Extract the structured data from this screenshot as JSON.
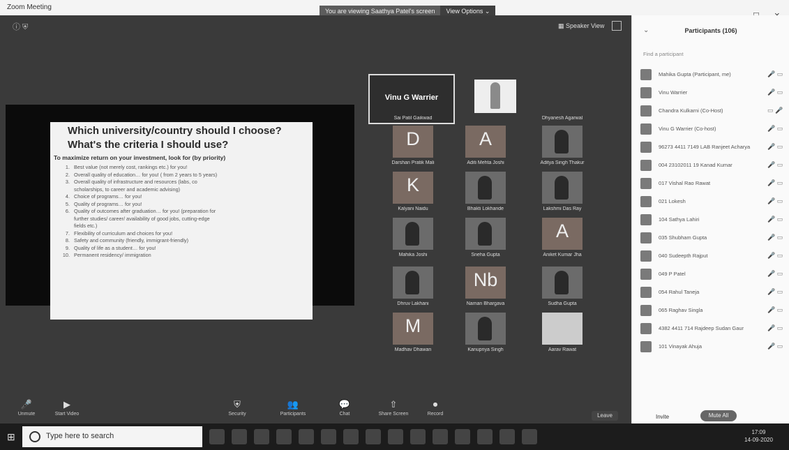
{
  "window": {
    "title": "Zoom Meeting",
    "minimize": "–",
    "maximize": "□",
    "close": "×"
  },
  "view_bar": {
    "notice": "You are viewing Saathya Patel's screen",
    "view_options": "View Options ⌄"
  },
  "top": {
    "speaker_view": "Speaker View",
    "grid_icon": "▦"
  },
  "slide": {
    "title1": "Which university/country should I choose?",
    "title2": "What's the criteria I should use?",
    "intro": "To maximize return on your investment, look for (by priority)",
    "items": [
      {
        "n": "1.",
        "text": "Best value (not merely cost, rankings etc.) for you!"
      },
      {
        "n": "2.",
        "text": "Overall quality of education… for you! ( from 2 years to 5 years)"
      },
      {
        "n": "3.",
        "text": "Overall quality of infrastructure and resources (labs, co"
      },
      {
        "n": "",
        "text": "scholarships, to career and academic advising)"
      },
      {
        "n": "4.",
        "text": "Choice of programs… for you!"
      },
      {
        "n": "5.",
        "text": "Quality of programs… for you!"
      },
      {
        "n": "6.",
        "text": "Quality of outcomes after graduation… for you! (preparation for"
      },
      {
        "n": "",
        "text": "further studies/ career/ availability of good jobs, cutting-edge"
      },
      {
        "n": "",
        "text": "fields etc.)"
      },
      {
        "n": "7.",
        "text": "Flexibility of curriculum and choices for you!"
      },
      {
        "n": "8.",
        "text": "Safety and community (friendly, immigrant-friendly)"
      },
      {
        "n": "9.",
        "text": "Quality of life as a student… for you!"
      },
      {
        "n": "10.",
        "text": "Permanent residency/ immigration"
      }
    ]
  },
  "host": {
    "name": "Vinu G Warrier"
  },
  "tiles": [
    {
      "letter": "",
      "name": "Sai Patil Gaikwad"
    },
    {
      "letter": "",
      "name": "Dhyanesh Agarwal"
    },
    {
      "letter": "D",
      "name": "Darshan Pratik Mali"
    },
    {
      "letter": "A",
      "name": "Aditi Mehta Joshi"
    },
    {
      "letter": "",
      "name": "Aditya Singh Thakur"
    },
    {
      "letter": "K",
      "name": "Kalyani Naidu"
    },
    {
      "letter": "",
      "name": "Bhakti Lokhande"
    },
    {
      "letter": "",
      "name": "Lakshmi Das Ray"
    },
    {
      "letter": "",
      "name": "Mahika Joshi"
    },
    {
      "letter": "",
      "name": "Sneha Gupta"
    },
    {
      "letter": "A",
      "name": "Aniket Kumar Jha"
    },
    {
      "letter": "",
      "name": "Dhruv Lakhani"
    },
    {
      "letter": "Nb",
      "name": "Naman Bhargava"
    },
    {
      "letter": "",
      "name": "Sudha Gupta"
    },
    {
      "letter": "M",
      "name": "Madhav Dhawan"
    },
    {
      "letter": "",
      "name": "Kanupriya Singh"
    },
    {
      "letter": "",
      "name": "Aarav Rawat"
    }
  ],
  "toolbar": [
    {
      "icon": "🎤",
      "label": "Unmute"
    },
    {
      "icon": "▶",
      "label": "Start Video"
    },
    {
      "icon": "⛨",
      "label": "Security"
    },
    {
      "icon": "👥",
      "label": "Participants"
    },
    {
      "icon": "💬",
      "label": "Chat"
    },
    {
      "icon": "⇧",
      "label": "Share Screen"
    },
    {
      "icon": "⏺",
      "label": "Record"
    }
  ],
  "leave": "Leave",
  "panel": {
    "title": "Participants (106)",
    "find": "Find a participant",
    "invite": "Invite",
    "mute_all": "Mute All",
    "participants": [
      {
        "name": "Mahika Gupta (Participant, me)",
        "icons": "🎤 ▭"
      },
      {
        "name": "Vinu Warrier",
        "icons": "🎤 ▭"
      },
      {
        "name": "Chandra Kulkarni (Co-Host)",
        "icons": "▭ 🎤"
      },
      {
        "name": "Vinu G Warrier (Co-host)",
        "icons": "🎤 ▭"
      },
      {
        "name": "96273 4411 7149 LAB Ranjeet Acharya",
        "icons": "🎤 ▭"
      },
      {
        "name": "004 23102011 19 Kanad Kumar",
        "icons": "🎤 ▭"
      },
      {
        "name": "017 Vishal Rao Rawat",
        "icons": "🎤 ▭"
      },
      {
        "name": "021 Lokesh",
        "icons": "🎤 ▭"
      },
      {
        "name": "104 Sathya Lahiri",
        "icons": "🎤 ▭"
      },
      {
        "name": "035 Shubham Gupta",
        "icons": "🎤 ▭"
      },
      {
        "name": "040 Sudeepth Rajput",
        "icons": "🎤 ▭"
      },
      {
        "name": "049 P Patel",
        "icons": "🎤 ▭"
      },
      {
        "name": "054 Rahul Taneja",
        "icons": "🎤 ▭"
      },
      {
        "name": "065 Raghav Singla",
        "icons": "🎤 ▭"
      },
      {
        "name": "4382 4411 714 Rajdeep Sudan Gaur",
        "icons": "🎤 ▭"
      },
      {
        "name": "101 Vinayak Ahuja",
        "icons": "🎤 ▭"
      }
    ]
  },
  "taskbar": {
    "search_placeholder": "Type here to search",
    "time": "17:09",
    "date": "14-09-2020"
  }
}
